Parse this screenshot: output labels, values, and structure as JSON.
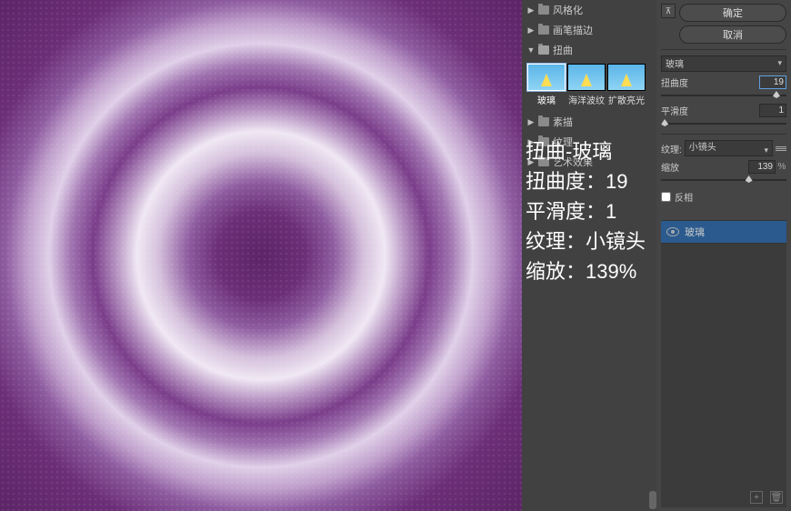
{
  "preview_filter_title": "扭曲-玻璃",
  "overlay": {
    "line1": "扭曲-玻璃",
    "line2": "扭曲度：19",
    "line3": "平滑度：1",
    "line4": "纹理：小镜头",
    "line5": "缩放：139%"
  },
  "folders": [
    {
      "label": "风格化",
      "open": false
    },
    {
      "label": "画笔描边",
      "open": false
    },
    {
      "label": "扭曲",
      "open": true
    },
    {
      "label": "素描",
      "open": false
    },
    {
      "label": "纹理",
      "open": false
    },
    {
      "label": "艺术效果",
      "open": false
    }
  ],
  "thumbs": [
    {
      "label": "玻璃",
      "selected": true
    },
    {
      "label": "海洋波纹",
      "selected": false
    },
    {
      "label": "扩散亮光",
      "selected": false
    }
  ],
  "buttons": {
    "ok": "确定",
    "cancel": "取消"
  },
  "filter_select": "玻璃",
  "params": {
    "distortion": {
      "label": "扭曲度",
      "value": "19",
      "pos": 92
    },
    "smoothness": {
      "label": "平滑度",
      "value": "1",
      "pos": 3
    },
    "texture": {
      "label": "纹理:",
      "value": "小镜头"
    },
    "scale": {
      "label": "缩放",
      "value": "139",
      "suffix": "%",
      "pos": 70
    },
    "invert": {
      "label": "反相"
    }
  },
  "layers": [
    {
      "label": "玻璃"
    }
  ],
  "bottom_icons": {
    "new": "+",
    "trash": "🗑"
  }
}
